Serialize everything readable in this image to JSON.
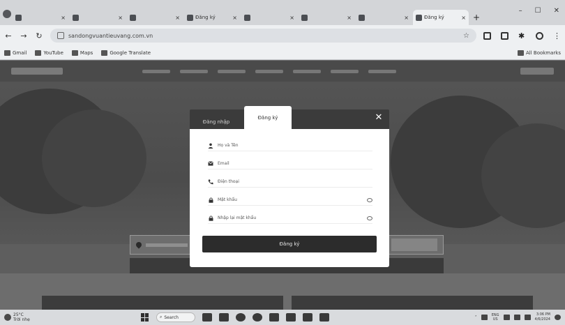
{
  "browser": {
    "tabs": [
      {
        "label": "",
        "active": false
      },
      {
        "label": "",
        "active": false
      },
      {
        "label": "",
        "active": false
      },
      {
        "label": "Đăng ký",
        "active": false
      },
      {
        "label": "",
        "active": false
      },
      {
        "label": "",
        "active": false
      },
      {
        "label": "",
        "active": false
      },
      {
        "label": "Đăng ký",
        "active": true
      }
    ],
    "new_tab": "+",
    "url": "sandongvuantieuvang.com.vn"
  },
  "bookmarks": [
    {
      "label": "Gmail"
    },
    {
      "label": "YouTube"
    },
    {
      "label": "Maps"
    },
    {
      "label": "Google Translate"
    }
  ],
  "bookmarks_all": "All Bookmarks",
  "modal": {
    "tab_login": "Đăng nhập",
    "tab_register": "Đăng ký",
    "close": "✕",
    "fields": [
      {
        "label": "Họ và Tên",
        "icon": "user-icon"
      },
      {
        "label": "Email",
        "icon": "email-icon"
      },
      {
        "label": "Điện thoại",
        "icon": "phone-icon"
      },
      {
        "label": "Mật khẩu",
        "icon": "lock-icon"
      },
      {
        "label": "Nhập lại mật khẩu",
        "icon": "lock-icon"
      }
    ],
    "submit": "Đăng ký"
  },
  "taskbar": {
    "search": "Search",
    "weather_temp": "25°C",
    "weather_desc": "Trời nhẹ",
    "lang_top": "ENG",
    "lang_bottom": "US",
    "time": "3:06 PM",
    "date": "4/6/2024"
  }
}
